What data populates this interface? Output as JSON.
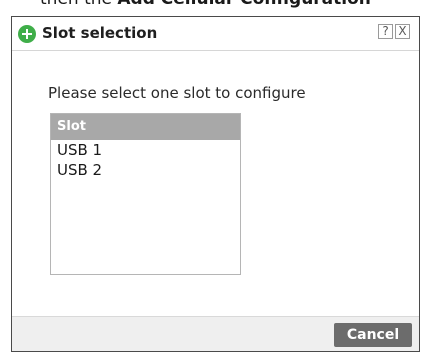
{
  "background_text": {
    "prefix": "then the ",
    "bold": "Add Cellular Configuration"
  },
  "dialog": {
    "title": "Slot selection",
    "title_icon": "add-circle-icon",
    "help_glyph": "?",
    "close_glyph": "X",
    "instruction": "Please select one slot to configure",
    "list": {
      "header": "Slot",
      "items": [
        "USB 1",
        "USB 2"
      ]
    },
    "cancel_label": "Cancel"
  },
  "colors": {
    "title_icon_green": "#3fae49",
    "list_header_bg": "#a8a8a8",
    "cancel_bg": "#6c6c6c",
    "footer_bg": "#efefef"
  }
}
